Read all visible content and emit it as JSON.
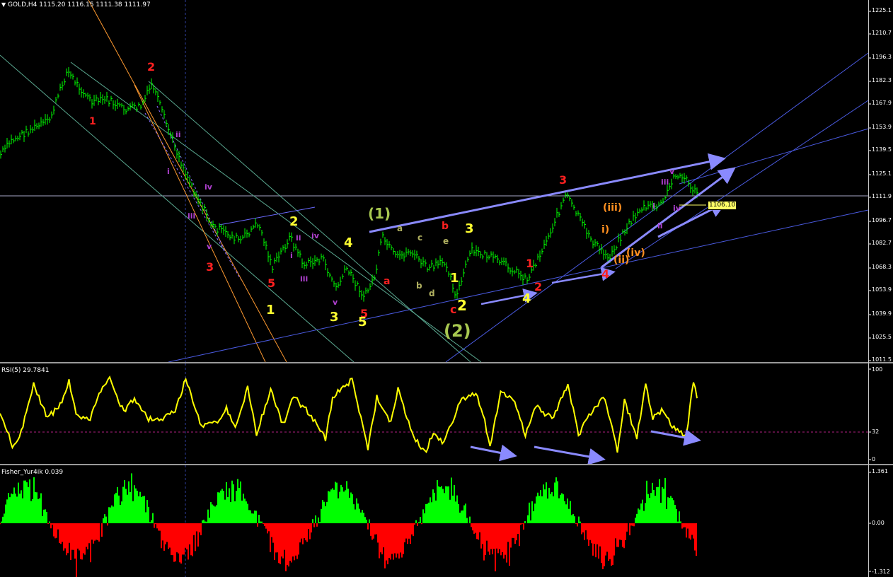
{
  "main": {
    "menu_icon": "triangle-down-icon",
    "header": "GOLD,H4  1115.20 1116.15 1111.38 1111.97",
    "price_box": "1106.10",
    "price_scale": [
      "1225.1",
      "1210.7",
      "1196.3",
      "1182.3",
      "1167.9",
      "1153.9",
      "1139.5",
      "1125.1",
      "1111.9",
      "1096.7",
      "1082.7",
      "1068.3",
      "1053.9",
      "1039.9",
      "1025.5",
      "1011.5"
    ],
    "waves": [
      {
        "t": "2",
        "c": "#ff2020",
        "s": 16
      },
      {
        "t": "1",
        "c": "#ff2020",
        "s": 14
      },
      {
        "t": "ii",
        "c": "#b040d0",
        "s": 11
      },
      {
        "t": "i",
        "c": "#b040d0",
        "s": 11
      },
      {
        "t": "iv",
        "c": "#b040d0",
        "s": 11
      },
      {
        "t": "iii",
        "c": "#b040d0",
        "s": 11
      },
      {
        "t": "v",
        "c": "#b040d0",
        "s": 11
      },
      {
        "t": "3",
        "c": "#ff2020",
        "s": 16
      },
      {
        "t": "2",
        "c": "#ffff30",
        "s": 18
      },
      {
        "t": "ii",
        "c": "#b040d0",
        "s": 11
      },
      {
        "t": "i",
        "c": "#b040d0",
        "s": 11
      },
      {
        "t": "iii",
        "c": "#b040d0",
        "s": 11
      },
      {
        "t": "iv",
        "c": "#b040d0",
        "s": 11
      },
      {
        "t": "5",
        "c": "#ff2020",
        "s": 16
      },
      {
        "t": "1",
        "c": "#ffff30",
        "s": 18
      },
      {
        "t": "4",
        "c": "#ffff30",
        "s": 18
      },
      {
        "t": "v",
        "c": "#b040d0",
        "s": 11
      },
      {
        "t": "3",
        "c": "#ffff30",
        "s": 18
      },
      {
        "t": "5",
        "c": "#ff2020",
        "s": 16
      },
      {
        "t": "5",
        "c": "#ffff30",
        "s": 18
      },
      {
        "t": "(1)",
        "c": "#a8c850",
        "s": 20
      },
      {
        "t": "a",
        "c": "#b0b060",
        "s": 12
      },
      {
        "t": "a",
        "c": "#ff2020",
        "s": 14
      },
      {
        "t": "b",
        "c": "#b0b060",
        "s": 12
      },
      {
        "t": "c",
        "c": "#b0b060",
        "s": 12
      },
      {
        "t": "d",
        "c": "#b0b060",
        "s": 12
      },
      {
        "t": "b",
        "c": "#ff2020",
        "s": 14
      },
      {
        "t": "e",
        "c": "#b0b060",
        "s": 12
      },
      {
        "t": "1",
        "c": "#ffff30",
        "s": 18
      },
      {
        "t": "3",
        "c": "#ffff30",
        "s": 18
      },
      {
        "t": "c",
        "c": "#ff2020",
        "s": 16
      },
      {
        "t": "2",
        "c": "#ffff30",
        "s": 20
      },
      {
        "t": "(2)",
        "c": "#a8c850",
        "s": 24
      },
      {
        "t": "4",
        "c": "#ffff30",
        "s": 18
      },
      {
        "t": "1",
        "c": "#ff2020",
        "s": 16
      },
      {
        "t": "2",
        "c": "#ff2020",
        "s": 16
      },
      {
        "t": "3",
        "c": "#ff2020",
        "s": 16
      },
      {
        "t": "(iii)",
        "c": "#ff9020",
        "s": 14
      },
      {
        "t": "i)",
        "c": "#ff9020",
        "s": 14
      },
      {
        "t": "(ii)",
        "c": "#ff9020",
        "s": 14
      },
      {
        "t": "(iv)",
        "c": "#ff9020",
        "s": 14
      },
      {
        "t": "4",
        "c": "#ff2020",
        "s": 16
      },
      {
        "t": "i",
        "c": "#b040d0",
        "s": 11
      },
      {
        "t": "ii",
        "c": "#b040d0",
        "s": 11
      },
      {
        "t": "iii",
        "c": "#b040d0",
        "s": 11
      },
      {
        "t": "iv",
        "c": "#b040d0",
        "s": 11
      },
      {
        "t": "v",
        "c": "#b040d0",
        "s": 11
      }
    ]
  },
  "rsi": {
    "header": "RSI(5) 29.7841",
    "scale": [
      "100",
      "32",
      "0"
    ]
  },
  "fisher": {
    "header": "Fisher_Yur4ik 0.039",
    "scale": [
      "1.361",
      "0.00",
      "-1.312"
    ]
  },
  "colors": {
    "bull_bar": "#00ff00",
    "rsi_line": "#ffff00",
    "fisher_pos": "#00ff00",
    "fisher_neg": "#ff0000",
    "channel": "#4a5ae0",
    "arrow": "#8a8aff",
    "scale_text": "#ffffff"
  }
}
